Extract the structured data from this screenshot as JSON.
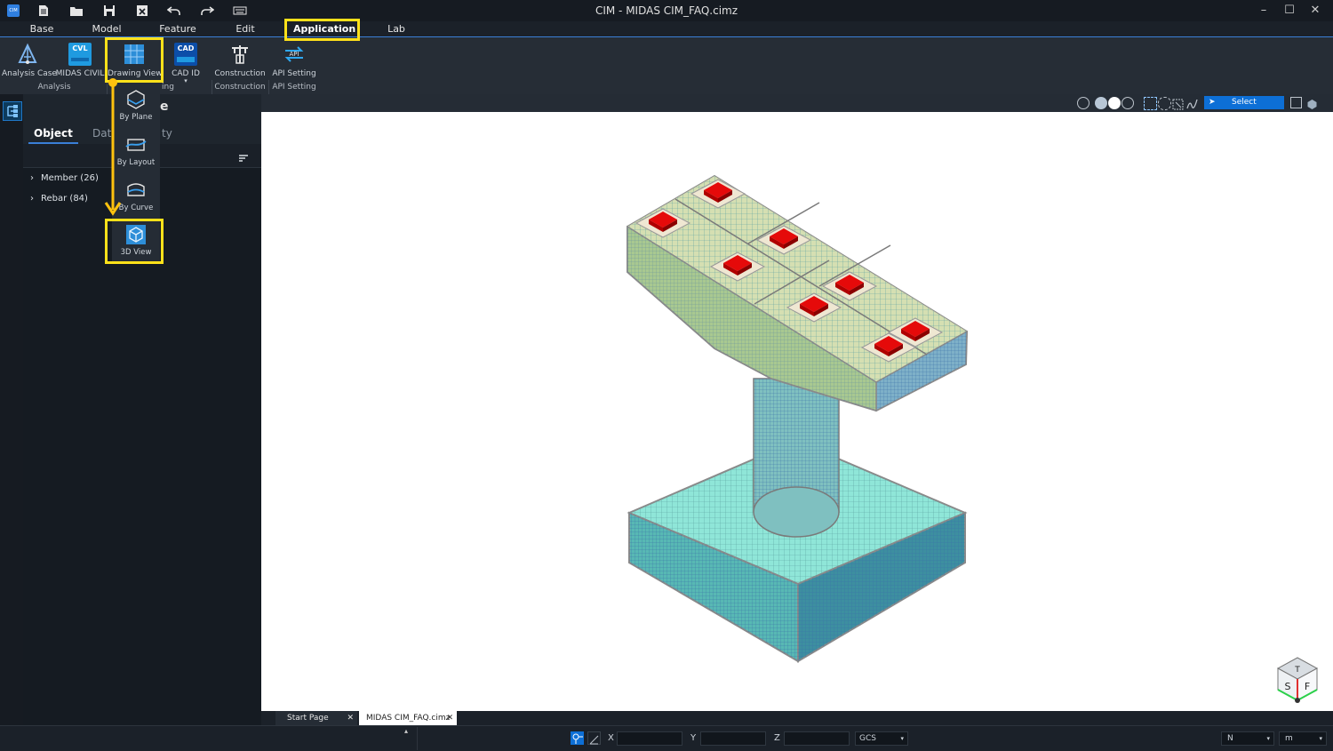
{
  "app": {
    "title": "CIM - MIDAS CIM_FAQ.cimz",
    "logo_text": "CIM"
  },
  "menu": [
    "Base",
    "Model",
    "Feature",
    "Edit",
    "Application",
    "Lab"
  ],
  "ribbon": {
    "buttons": [
      {
        "label": "Analysis Case",
        "icon": "analysis-case-icon"
      },
      {
        "label": "MIDAS CIVIL",
        "icon": "cvl-icon",
        "badge": "CVL"
      },
      {
        "label": "Drawing View",
        "icon": "drawing-view-icon"
      },
      {
        "label": "CAD ID",
        "icon": "cad-icon",
        "badge": "CAD"
      },
      {
        "label": "Construction",
        "icon": "construction-icon"
      },
      {
        "label": "API Setting",
        "icon": "api-icon",
        "badge": "API"
      }
    ],
    "groups": [
      "Analysis",
      "ing",
      "Construction",
      "API Setting"
    ]
  },
  "dropdown": {
    "items": [
      {
        "label": "By Plane",
        "icon": "by-plane-icon"
      },
      {
        "label": "By Layout",
        "icon": "by-layout-icon"
      },
      {
        "label": "By Curve",
        "icon": "by-curve-icon"
      },
      {
        "label": "3D View",
        "icon": "3d-view-icon"
      }
    ]
  },
  "panel": {
    "title_fragment": "e",
    "tabs": [
      "Object",
      "Dat",
      "ty"
    ],
    "tree": [
      {
        "label": "Member (26)"
      },
      {
        "label": "Rebar (84)"
      }
    ]
  },
  "viewport_toolbar": {
    "select_label": "Select"
  },
  "doc_tabs": [
    "Start Page",
    "MIDAS CIM_FAQ.cimz"
  ],
  "status": {
    "x_label": "X",
    "y_label": "Y",
    "z_label": "Z",
    "coord_system": "GCS",
    "force_unit": "N",
    "length_unit": "m"
  },
  "nav_cube": {
    "faces": [
      "S",
      "F",
      "T"
    ]
  },
  "colors": {
    "highlight": "#ffe11a",
    "accent": "#3a7fd8",
    "pad_red": "#e50a0a"
  }
}
